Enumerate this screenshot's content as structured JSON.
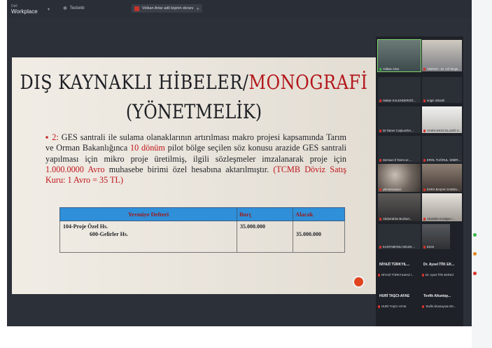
{
  "app": {
    "brand_small": "Dell",
    "brand_name": "Workplace",
    "tab_participants": "Teclonb",
    "tab_meeting": "Volkan Artar adli kişinin ekranı",
    "add_tab": "+"
  },
  "slide": {
    "title_part1": "DIŞ KAYNAKLI HİBELER/",
    "title_part2": "MONOGRAFİ",
    "title_line2": "(YÖNETMELİK)",
    "bullet": "▪",
    "num": "2:",
    "text_a": " GES santrali ile sulama olanaklarının artırılması makro projesi kapsamında Tarım ve Orman Bakanlığınca ",
    "red_a": "10 dönüm",
    "text_b": " pilot bölge seçilen söz konusu arazide GES santrali yapılması için mikro proje üretilmiş, ilgili sözleşmeler imzalanarak proje için ",
    "red_b": "1.000.0000 Avro",
    "text_c": " muhasebe birimi özel hesabına aktarılmıştır. ",
    "red_c": "(TCMB Döviz Satış Kuru: 1 Avro = 35 TL)",
    "table": {
      "headers": [
        "Yevmiye Defteri",
        "Borç",
        "Alacak"
      ],
      "row_account1": "104-Proje Özel Hs.",
      "row_account2": "600-Gelirler Hs.",
      "debit": "35.000.000",
      "credit": "35.000.000"
    }
  },
  "participants": {
    "tiles": [
      "Volkan Artar",
      "ABDGM - Dr. Arif Mege...",
      "Hakan KALENDEROĞ...",
      "engin özkanli",
      "Dr.Tamer Coşkun/DA...",
      "YASİN EKİCİ ELAZIĞ V...",
      "Semsun İl Tarım ve ...",
      "EROL TUĞRUL -İZMİR...",
      "yilmazsavasci",
      "ESRA BAŞAK SAMSU...",
      "Abdurrahim Bozkurt...",
      "Abdullah Erdoğan /...",
      "KASTAMONU OKUM-...",
      "Emre"
    ],
    "names_list": [
      {
        "big": "NİYAZİ TÜRKYIL...",
        "small": "NİYAZİ TÜRKYILMAZ /..."
      },
      {
        "big": "Dr. Aysel İTİK EK...",
        "small": "Dr. Aysel İTİK EKİNCİ"
      },
      {
        "big": "HURİ TAŞCI-AFAE",
        "small": "HURİ TAŞCI-AFAE"
      },
      {
        "big": "Tevfik Altuntay...",
        "small": "Tevfik Altuntaynat-OK..."
      }
    ]
  }
}
